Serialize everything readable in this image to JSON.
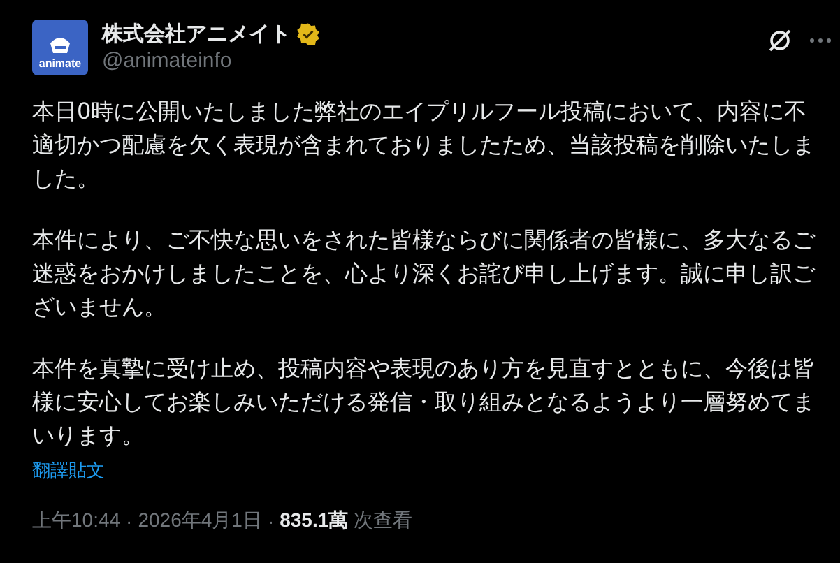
{
  "author": {
    "name": "株式会社アニメイト",
    "handle": "@animateinfo",
    "verified": true,
    "avatar_text": "animate"
  },
  "paragraphs": [
    "本日0時に公開いたしました弊社のエイプリルフール投稿において、内容に不適切かつ配慮を欠く表現が含まれておりましたため、当該投稿を削除いたしました。",
    "本件により、ご不快な思いをされた皆様ならびに関係者の皆様に、多大なるご迷惑をおかけしましたことを、心より深くお詫び申し上げます。誠に申し訳ございません。",
    "本件を真摯に受け止め、投稿内容や表現のあり方を見直すとともに、今後は皆様に安心してお楽しみいただける発信・取り組みとなるようより一層努めてまいります。"
  ],
  "translate_link": "翻譯貼文",
  "meta": {
    "time": "上午10:44",
    "separator_1": "·",
    "date": "2026年4月1日",
    "separator_2": "·",
    "views": "835.1萬",
    "views_label": "次查看"
  }
}
